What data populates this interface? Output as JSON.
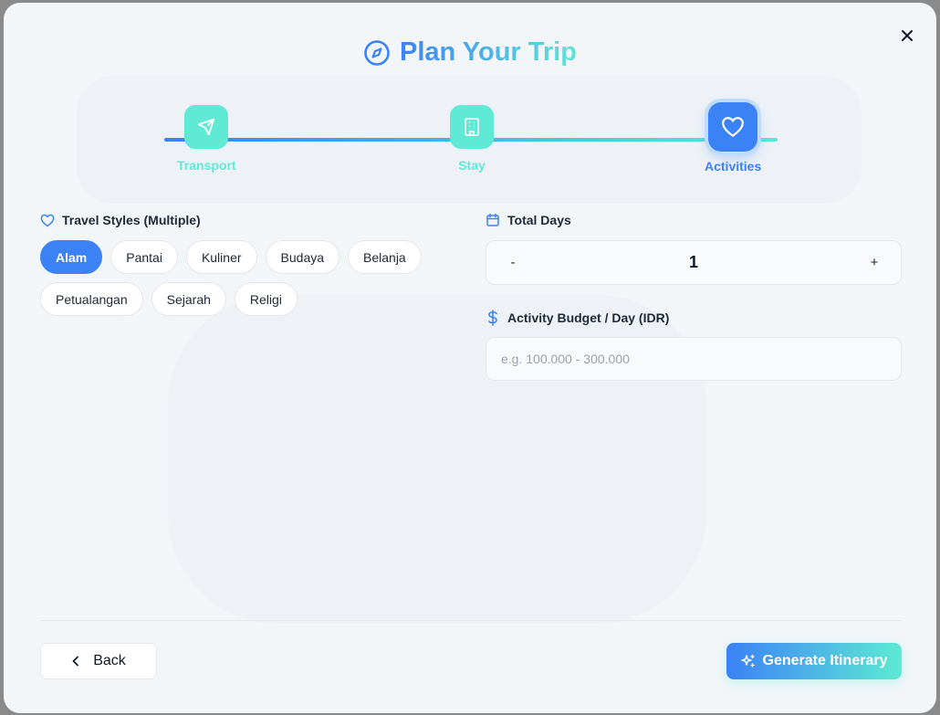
{
  "title": "Plan Your Trip",
  "steps": [
    {
      "label": "Transport",
      "icon": "plane-icon"
    },
    {
      "label": "Stay",
      "icon": "building-icon"
    },
    {
      "label": "Activities",
      "icon": "heart-icon"
    }
  ],
  "travel_styles": {
    "label": "Travel Styles (Multiple)",
    "options": [
      "Alam",
      "Pantai",
      "Kuliner",
      "Budaya",
      "Belanja",
      "Petualangan",
      "Sejarah",
      "Religi"
    ],
    "selected": "Alam"
  },
  "total_days": {
    "label": "Total Days",
    "minus": "-",
    "value": "1",
    "plus": "+"
  },
  "budget": {
    "label": "Activity Budget / Day (IDR)",
    "placeholder": "e.g. 100.000 - 300.000",
    "value": ""
  },
  "footer": {
    "back_label": "Back",
    "generate_label": "Generate Itinerary"
  },
  "colors": {
    "primary": "#3b82f6",
    "accent": "#5eead4",
    "background": "#f3f6f9"
  }
}
